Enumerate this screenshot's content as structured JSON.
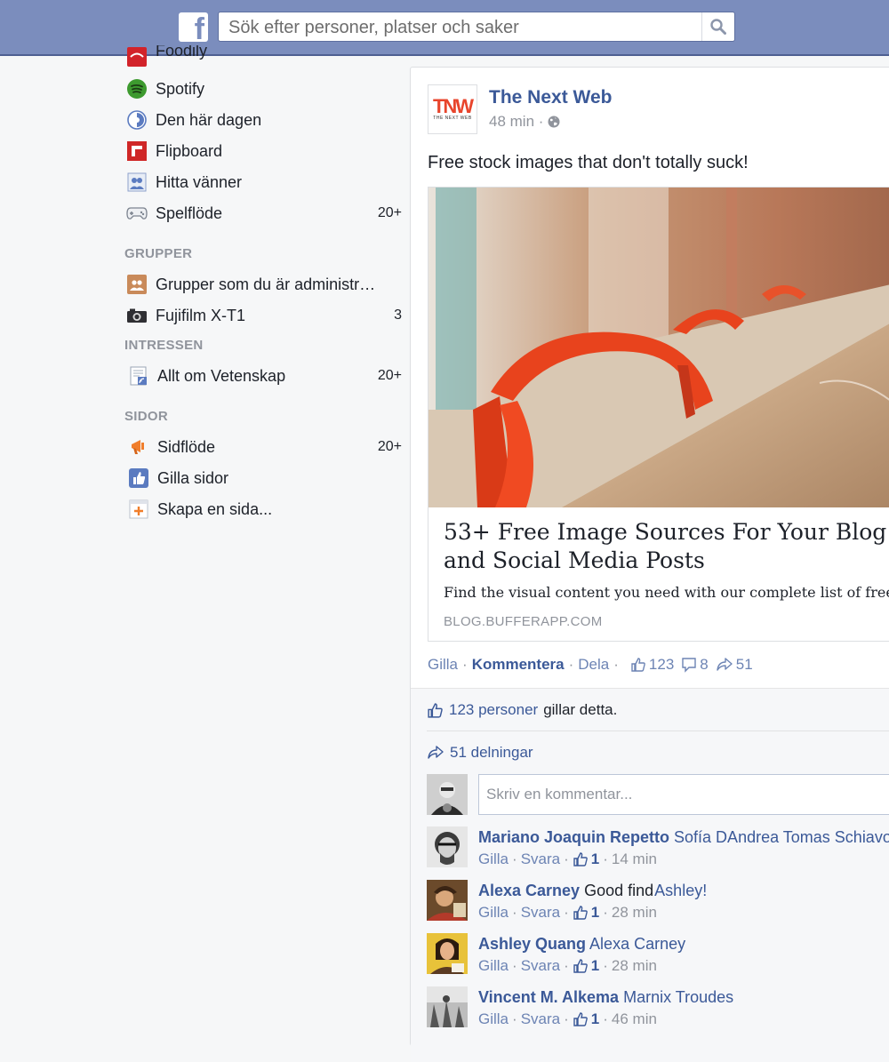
{
  "topbar": {
    "logo_letter": "f",
    "search_placeholder": "Sök efter personer, platser och saker"
  },
  "sidebar": {
    "apps": [
      {
        "label": "Foodily",
        "icon": "foodily-icon",
        "count": ""
      },
      {
        "label": "Spotify",
        "icon": "spotify-icon",
        "count": ""
      },
      {
        "label": "Den här dagen",
        "icon": "on-this-day-icon",
        "count": ""
      },
      {
        "label": "Flipboard",
        "icon": "flipboard-icon",
        "count": ""
      },
      {
        "label": "Hitta vänner",
        "icon": "find-friends-icon",
        "count": ""
      },
      {
        "label": "Spelflöde",
        "icon": "game-controller-icon",
        "count": "20+"
      }
    ],
    "groups_heading": "GRUPPER",
    "groups": [
      {
        "label": "Grupper som du är administr…",
        "icon": "group-admin-icon",
        "count": ""
      },
      {
        "label": "Fujifilm X-T1",
        "icon": "camera-icon",
        "count": "3"
      }
    ],
    "interests_heading": "INTRESSEN",
    "interests": [
      {
        "label": "Allt om Vetenskap",
        "icon": "interest-list-icon",
        "count": "20+"
      }
    ],
    "pages_heading": "SIDOR",
    "pages": [
      {
        "label": "Sidflöde",
        "icon": "megaphone-icon",
        "count": "20+"
      },
      {
        "label": "Gilla sidor",
        "icon": "thumbs-up-icon",
        "count": ""
      },
      {
        "label": "Skapa en sida...",
        "icon": "create-page-icon",
        "count": ""
      }
    ]
  },
  "post": {
    "logo_text": "TNW",
    "logo_subtext": "THE NEXT WEB",
    "author": "The Next Web",
    "time": "48 min ·",
    "text": "Free stock images that don't totally suck!",
    "link": {
      "title": "53+ Free Image Sources For Your Blog and Social Media Posts",
      "description": "Find the visual content you need with our complete list of free image sources.",
      "source": "BLOG.BUFFERAPP.COM"
    },
    "actions": {
      "like": "Gilla",
      "comment": "Kommentera",
      "share": "Dela",
      "like_count": "123",
      "comment_count": "8",
      "share_count": "51"
    },
    "likes_summary": {
      "link": "123 personer",
      "rest": "gillar detta."
    },
    "shares_summary": "51 delningar",
    "comment_placeholder": "Skriv en kommentar...",
    "comments": [
      {
        "name": "Mariano Joaquin Repetto",
        "text": "Sofía DAndrea Tomas Schiavoni",
        "tagged": true,
        "like": "Gilla",
        "reply": "Svara",
        "likes": "1",
        "time": "14 min"
      },
      {
        "name": "Alexa Carney",
        "text": "Good find",
        "mention": "Ashley!",
        "like": "Gilla",
        "reply": "Svara",
        "likes": "1",
        "time": "28 min"
      },
      {
        "name": "Ashley Quang",
        "text": "Alexa Carney",
        "tagged": true,
        "like": "Gilla",
        "reply": "Svara",
        "likes": "1",
        "time": "28 min"
      },
      {
        "name": "Vincent M. Alkema",
        "text": "Marnix Troudes",
        "tagged": true,
        "like": "Gilla",
        "reply": "Svara",
        "likes": "1",
        "time": "46 min"
      }
    ]
  },
  "colors": {
    "topbar": "#7b8dbd",
    "link": "#3b5998",
    "muted": "#90949c",
    "background": "#f6f7f8"
  }
}
